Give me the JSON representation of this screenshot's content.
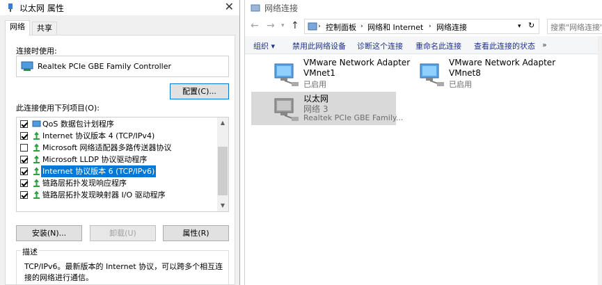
{
  "props": {
    "title": "以太网 属性",
    "close": "✕",
    "tabs": [
      {
        "label": "网络",
        "active": true
      },
      {
        "label": "共享",
        "active": false
      }
    ],
    "connect_using_label": "连接时使用:",
    "device_name": "Realtek PCIe GBE Family Controller",
    "configure_button": "配置(C)...",
    "items_label": "此连接使用下列项目(O):",
    "items": [
      {
        "label": "QoS 数据包计划程序",
        "checked": true
      },
      {
        "label": "Internet 协议版本 4 (TCP/IPv4)",
        "checked": true
      },
      {
        "label": "Microsoft 网络适配器多路传送器协议",
        "checked": false
      },
      {
        "label": "Microsoft LLDP 协议驱动程序",
        "checked": true
      },
      {
        "label": "Internet 协议版本 6 (TCP/IPv6)",
        "checked": true,
        "selected": true
      },
      {
        "label": "链路层拓扑发现响应程序",
        "checked": true
      },
      {
        "label": "链路层拓扑发现映射器 I/O 驱动程序",
        "checked": true
      }
    ],
    "install_button": "安装(N)...",
    "uninstall_button": "卸载(U)",
    "properties_button": "属性(R)",
    "description_title": "描述",
    "description_text": "TCP/IPv6。最新版本的 Internet 协议，可以跨多个相互连接的网络进行通信。"
  },
  "netwin": {
    "title": "网络连接",
    "breadcrumbs": [
      "控制面板",
      "网络和 Internet",
      "网络连接"
    ],
    "search_placeholder": "搜索\"网络连接\"",
    "toolbar": [
      "组织 ▾",
      "禁用此网络设备",
      "诊断这个连接",
      "重命名此连接",
      "查看此连接的状态",
      "»"
    ],
    "adapters": [
      {
        "name": "VMware Network Adapter",
        "line2": "VMnet1",
        "status": "已启用",
        "selected": false
      },
      {
        "name": "VMware Network Adapter",
        "line2": "VMnet8",
        "status": "已启用",
        "selected": false
      },
      {
        "name": "以太网",
        "line2": "网络  3",
        "status": "Realtek PCIe GBE Family...",
        "selected": true
      }
    ]
  },
  "colors": {
    "accent": "#0078d7",
    "selection_bg": "#d9d9d9",
    "toolbar_text": "#1e3287"
  }
}
